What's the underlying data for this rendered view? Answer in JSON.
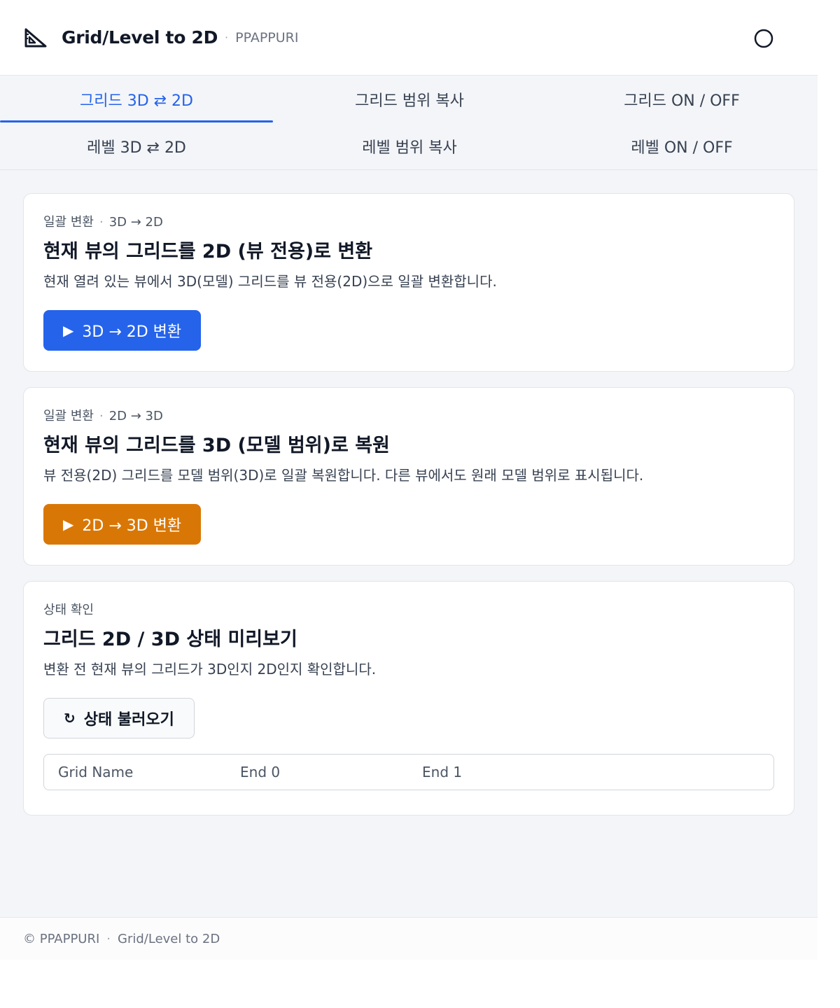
{
  "header": {
    "title": "Grid/Level to 2D",
    "separator": "·",
    "brand": "PPAPPURI"
  },
  "tabs": [
    {
      "label": "그리드 3D ⇄ 2D",
      "active": true
    },
    {
      "label": "그리드 범위 복사",
      "active": false
    },
    {
      "label": "그리드 ON / OFF",
      "active": false
    },
    {
      "label": "레벨 3D ⇄ 2D",
      "active": false
    },
    {
      "label": "레벨 범위 복사",
      "active": false
    },
    {
      "label": "레벨 ON / OFF",
      "active": false
    }
  ],
  "cards": [
    {
      "eyebrow": "일괄 변환",
      "eyebrow_sub": "3D → 2D",
      "title": "현재 뷰의 그리드를 2D (뷰 전용)로 변환",
      "desc": "현재 열려 있는 뷰에서 3D(모델) 그리드를 뷰 전용(2D)으로 일괄 변환합니다.",
      "button": "3D → 2D 변환",
      "button_color": "#2563eb"
    },
    {
      "eyebrow": "일괄 변환",
      "eyebrow_sub": "2D → 3D",
      "title": "현재 뷰의 그리드를 3D (모델 범위)로 복원",
      "desc": "뷰 전용(2D) 그리드를 모델 범위(3D)로 일괄 복원합니다. 다른 뷰에서도 원래 모델 범위로 표시됩니다.",
      "button": "2D → 3D 변환",
      "button_color": "#d97706"
    },
    {
      "eyebrow": "상태 확인",
      "title": "그리드 2D / 3D 상태 미리보기",
      "desc": "변환 전 현재 뷰의 그리드가 3D인지 2D인지 확인합니다.",
      "button": "상태 불러오기"
    }
  ],
  "status_table": {
    "columns": [
      "Grid Name",
      "End 0",
      "End 1"
    ]
  },
  "footer": {
    "copyright": "© PPAPPURI",
    "separator": "·",
    "product": "Grid/Level to 2D"
  },
  "colors": {
    "accent": "#2563eb",
    "orange": "#d97706"
  },
  "icons": {
    "logo": "triangle-ruler-icon",
    "settings": "settings-circle-icon",
    "play": "play-icon",
    "refresh": "refresh-icon"
  }
}
